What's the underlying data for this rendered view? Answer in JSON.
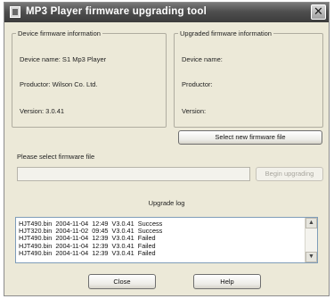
{
  "window": {
    "title": "MP3 Player firmware upgrading tool",
    "close_glyph": "✕"
  },
  "device_info": {
    "legend": "Device firmware information",
    "name": "Device name: S1 Mp3 Player",
    "productor": "Productor: Wilson Co. Ltd.",
    "version": "Version: 3.0.41"
  },
  "upgraded_info": {
    "legend": "Upgraded firmware information",
    "name": "Device name:",
    "productor": "Productor:",
    "version": "Version:"
  },
  "buttons": {
    "select_file": "Select new firmware file",
    "begin_upgrading": "Begin upgrading",
    "close": "Close",
    "help": "Help"
  },
  "file_select": {
    "label": "Please select firmware file",
    "value": ""
  },
  "log": {
    "title": "Upgrade log",
    "entries": [
      "HJT490.bin  2004-11-04  12:49  V3.0.41  Success",
      "HJT320.bin  2004-11-02  09:45  V3.0.41  Success",
      "HJT490.bin  2004-11-04  12:39  V3.0.41  Failed",
      "HJT490.bin  2004-11-04  12:39  V3.0.41  Failed",
      "HJT490.bin  2004-11-04  12:39  V3.0.41  Failed"
    ]
  },
  "icons": {
    "app": "app-icon",
    "scroll_up": "scroll-up-icon",
    "scroll_down": "scroll-down-icon"
  }
}
